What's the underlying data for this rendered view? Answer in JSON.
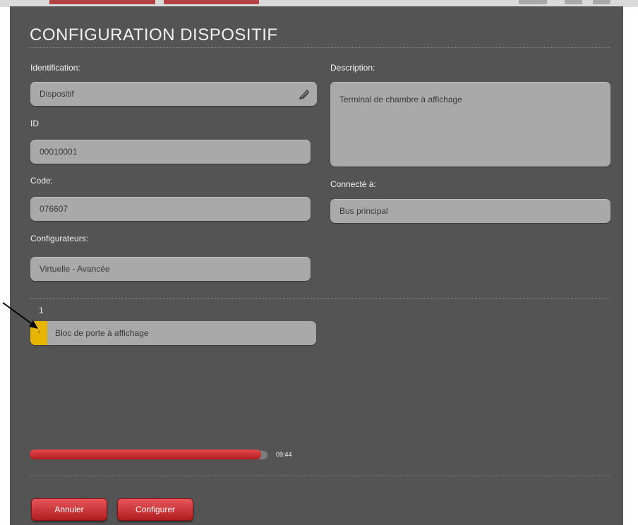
{
  "page": {
    "title": "CONFIGURATION DISPOSITIF"
  },
  "form": {
    "identification_label": "Identification:",
    "identification_value": "Dispositif",
    "id_label": "ID",
    "id_value": "00010001",
    "code_label": "Code:",
    "code_value": "076607",
    "configurateurs_label": "Configurateurs:",
    "configurateurs_value": "Virtuelle - Avancée",
    "description_label": "Description:",
    "description_value": "Terminal de chambre à affichage",
    "connecte_label": "Connecté à:",
    "connecte_value": "Bus principal"
  },
  "items": [
    {
      "number": "1",
      "handle_glyph": "+",
      "label": "Bloc de porte à affichage"
    }
  ],
  "progress": {
    "fraction": 0.97,
    "time": "09:44"
  },
  "buttons": {
    "cancel": "Annuler",
    "configure": "Configurer"
  },
  "colors": {
    "panel_bg": "#545454",
    "field_bg": "#a9a9a9",
    "accent_red": "#c52a2d",
    "handle_yellow": "#e7b400"
  },
  "icons": {
    "edit": "pencil-icon",
    "pointer": "arrow-pointer"
  }
}
